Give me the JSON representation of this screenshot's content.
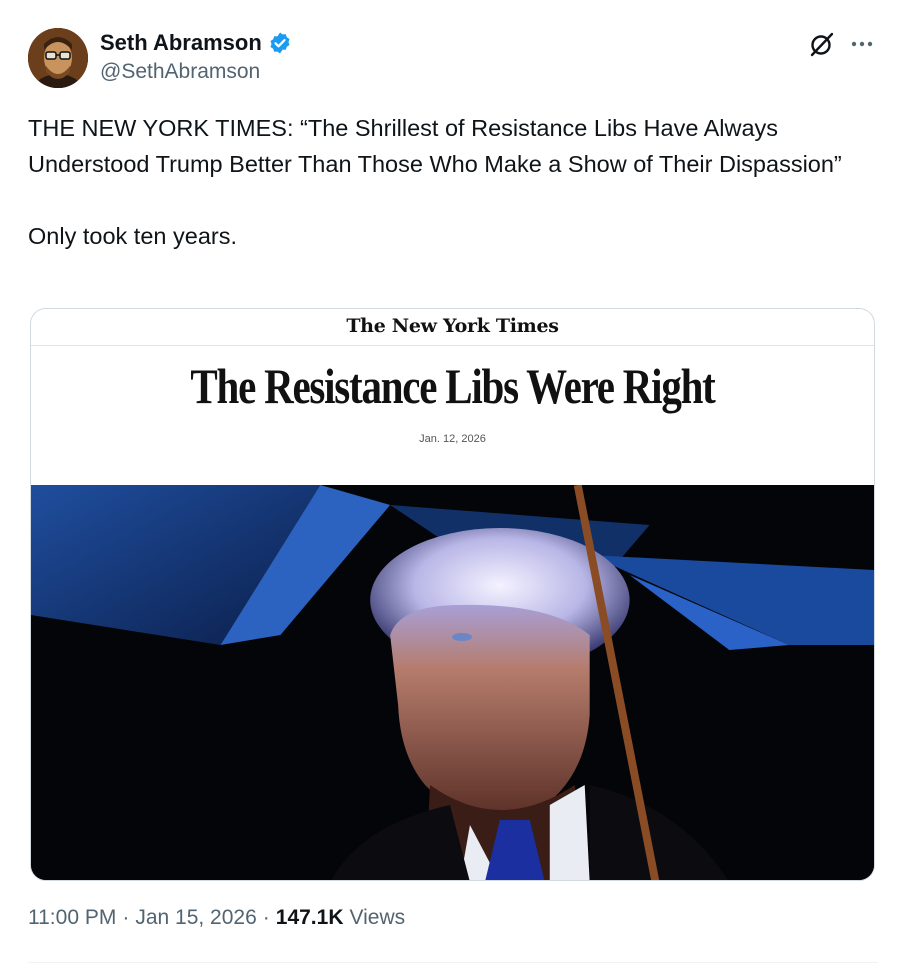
{
  "author": {
    "display_name": "Seth Abramson",
    "handle": "@SethAbramson",
    "verified": true,
    "verified_color": "#1d9bf0"
  },
  "header_icons": [
    "grok-icon",
    "more-icon"
  ],
  "tweet": {
    "paragraph_1": "THE NEW YORK TIMES: “The Shrillest of Resistance Libs Have Always Understood Trump Better Than Those Who Make a Show of Their Dispassion”",
    "paragraph_2": "Only took ten years."
  },
  "media": {
    "masthead": "The New York Times",
    "headline": "The Resistance Libs Were Right",
    "date": "Jan. 12, 2026"
  },
  "footer": {
    "time": "11:00 PM",
    "separator": "·",
    "date": "Jan 15, 2026",
    "views_count": "147.1K",
    "views_label": "Views"
  }
}
